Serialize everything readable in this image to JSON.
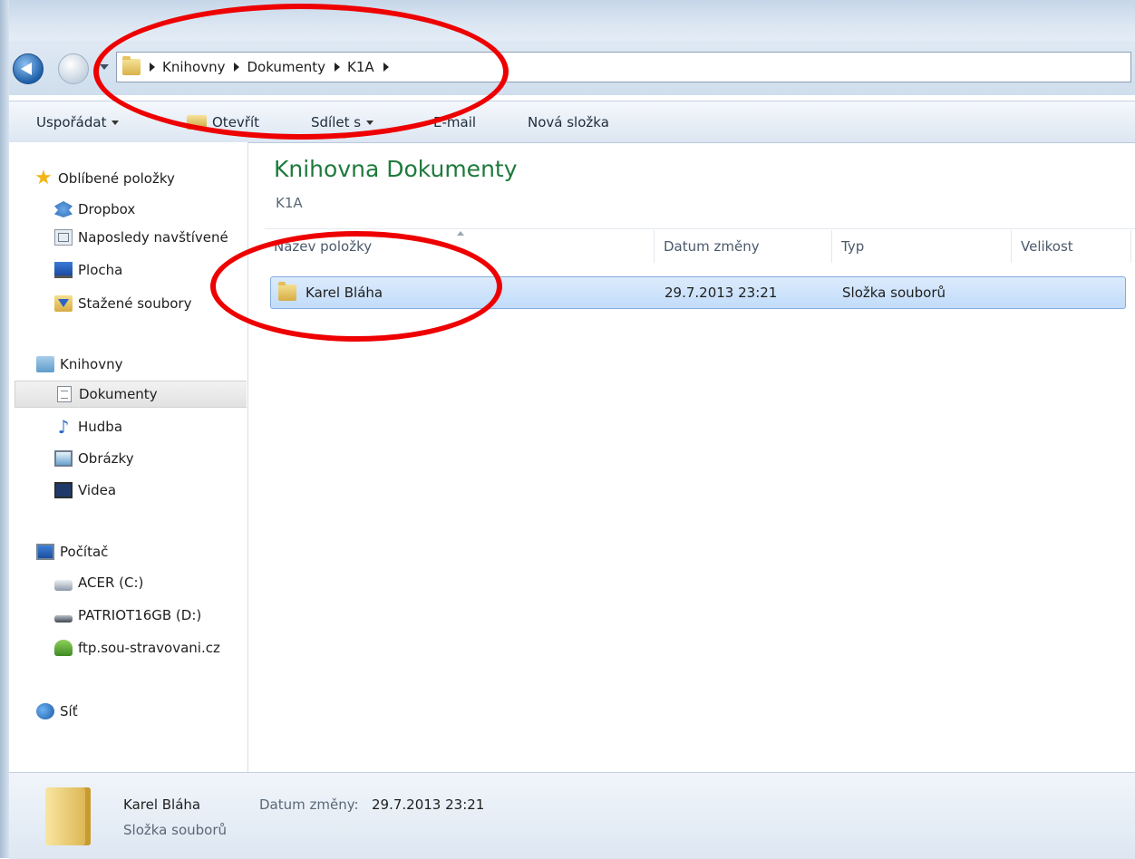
{
  "address": {
    "crumbs": [
      "Knihovny",
      "Dokumenty",
      "K1A"
    ]
  },
  "toolbar": {
    "organize_label": "Uspořádat",
    "open_label": "Otevřít",
    "share_label": "Sdílet s",
    "email_label": "E-mail",
    "new_folder_label": "Nová složka"
  },
  "sidebar": {
    "favorites": {
      "label": "Oblíbené položky",
      "items": [
        {
          "label": "Dropbox",
          "icon": "dropbox-icon"
        },
        {
          "label": "Naposledy navštívené",
          "icon": "recent-places-icon"
        },
        {
          "label": "Plocha",
          "icon": "desktop-icon"
        },
        {
          "label": "Stažené soubory",
          "icon": "downloads-icon"
        }
      ]
    },
    "libraries": {
      "label": "Knihovny",
      "items": [
        {
          "label": "Dokumenty",
          "icon": "documents-icon",
          "selected": true
        },
        {
          "label": "Hudba",
          "icon": "music-icon"
        },
        {
          "label": "Obrázky",
          "icon": "pictures-icon"
        },
        {
          "label": "Videa",
          "icon": "videos-icon"
        }
      ]
    },
    "computer": {
      "label": "Počítač",
      "items": [
        {
          "label": "ACER (C:)",
          "icon": "drive-c-icon"
        },
        {
          "label": "PATRIOT16GB (D:)",
          "icon": "usb-drive-icon"
        },
        {
          "label": "ftp.sou-stravovani.cz",
          "icon": "ftp-location-icon"
        }
      ]
    },
    "network": {
      "label": "Síť"
    }
  },
  "content": {
    "library_title": "Knihovna Dokumenty",
    "library_subtitle": "K1A",
    "columns": [
      "Název položky",
      "Datum změny",
      "Typ",
      "Velikost"
    ],
    "rows": [
      {
        "name": "Karel Bláha",
        "date": "29.7.2013 23:21",
        "type": "Složka souborů",
        "size": ""
      }
    ]
  },
  "status": {
    "name": "Karel Bláha",
    "type": "Složka souborů",
    "date_label": "Datum změny:",
    "date_value": "29.7.2013 23:21"
  },
  "colors": {
    "annotation": "#ee0000",
    "library_title": "#1e7a3c",
    "selection": "#c1dcfa"
  }
}
